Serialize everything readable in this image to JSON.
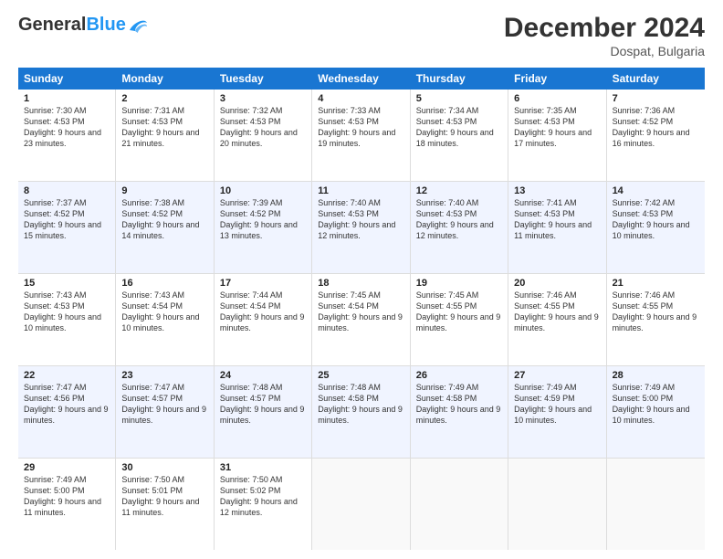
{
  "header": {
    "logo_general": "General",
    "logo_blue": "Blue",
    "month_title": "December 2024",
    "location": "Dospat, Bulgaria"
  },
  "days_of_week": [
    "Sunday",
    "Monday",
    "Tuesday",
    "Wednesday",
    "Thursday",
    "Friday",
    "Saturday"
  ],
  "weeks": [
    [
      {
        "day": "1",
        "sunrise": "7:30 AM",
        "sunset": "4:53 PM",
        "daylight": "9 hours and 23 minutes."
      },
      {
        "day": "2",
        "sunrise": "7:31 AM",
        "sunset": "4:53 PM",
        "daylight": "9 hours and 21 minutes."
      },
      {
        "day": "3",
        "sunrise": "7:32 AM",
        "sunset": "4:53 PM",
        "daylight": "9 hours and 20 minutes."
      },
      {
        "day": "4",
        "sunrise": "7:33 AM",
        "sunset": "4:53 PM",
        "daylight": "9 hours and 19 minutes."
      },
      {
        "day": "5",
        "sunrise": "7:34 AM",
        "sunset": "4:53 PM",
        "daylight": "9 hours and 18 minutes."
      },
      {
        "day": "6",
        "sunrise": "7:35 AM",
        "sunset": "4:53 PM",
        "daylight": "9 hours and 17 minutes."
      },
      {
        "day": "7",
        "sunrise": "7:36 AM",
        "sunset": "4:52 PM",
        "daylight": "9 hours and 16 minutes."
      }
    ],
    [
      {
        "day": "8",
        "sunrise": "7:37 AM",
        "sunset": "4:52 PM",
        "daylight": "9 hours and 15 minutes."
      },
      {
        "day": "9",
        "sunrise": "7:38 AM",
        "sunset": "4:52 PM",
        "daylight": "9 hours and 14 minutes."
      },
      {
        "day": "10",
        "sunrise": "7:39 AM",
        "sunset": "4:52 PM",
        "daylight": "9 hours and 13 minutes."
      },
      {
        "day": "11",
        "sunrise": "7:40 AM",
        "sunset": "4:53 PM",
        "daylight": "9 hours and 12 minutes."
      },
      {
        "day": "12",
        "sunrise": "7:40 AM",
        "sunset": "4:53 PM",
        "daylight": "9 hours and 12 minutes."
      },
      {
        "day": "13",
        "sunrise": "7:41 AM",
        "sunset": "4:53 PM",
        "daylight": "9 hours and 11 minutes."
      },
      {
        "day": "14",
        "sunrise": "7:42 AM",
        "sunset": "4:53 PM",
        "daylight": "9 hours and 10 minutes."
      }
    ],
    [
      {
        "day": "15",
        "sunrise": "7:43 AM",
        "sunset": "4:53 PM",
        "daylight": "9 hours and 10 minutes."
      },
      {
        "day": "16",
        "sunrise": "7:43 AM",
        "sunset": "4:54 PM",
        "daylight": "9 hours and 10 minutes."
      },
      {
        "day": "17",
        "sunrise": "7:44 AM",
        "sunset": "4:54 PM",
        "daylight": "9 hours and 9 minutes."
      },
      {
        "day": "18",
        "sunrise": "7:45 AM",
        "sunset": "4:54 PM",
        "daylight": "9 hours and 9 minutes."
      },
      {
        "day": "19",
        "sunrise": "7:45 AM",
        "sunset": "4:55 PM",
        "daylight": "9 hours and 9 minutes."
      },
      {
        "day": "20",
        "sunrise": "7:46 AM",
        "sunset": "4:55 PM",
        "daylight": "9 hours and 9 minutes."
      },
      {
        "day": "21",
        "sunrise": "7:46 AM",
        "sunset": "4:55 PM",
        "daylight": "9 hours and 9 minutes."
      }
    ],
    [
      {
        "day": "22",
        "sunrise": "7:47 AM",
        "sunset": "4:56 PM",
        "daylight": "9 hours and 9 minutes."
      },
      {
        "day": "23",
        "sunrise": "7:47 AM",
        "sunset": "4:57 PM",
        "daylight": "9 hours and 9 minutes."
      },
      {
        "day": "24",
        "sunrise": "7:48 AM",
        "sunset": "4:57 PM",
        "daylight": "9 hours and 9 minutes."
      },
      {
        "day": "25",
        "sunrise": "7:48 AM",
        "sunset": "4:58 PM",
        "daylight": "9 hours and 9 minutes."
      },
      {
        "day": "26",
        "sunrise": "7:49 AM",
        "sunset": "4:58 PM",
        "daylight": "9 hours and 9 minutes."
      },
      {
        "day": "27",
        "sunrise": "7:49 AM",
        "sunset": "4:59 PM",
        "daylight": "9 hours and 10 minutes."
      },
      {
        "day": "28",
        "sunrise": "7:49 AM",
        "sunset": "5:00 PM",
        "daylight": "9 hours and 10 minutes."
      }
    ],
    [
      {
        "day": "29",
        "sunrise": "7:49 AM",
        "sunset": "5:00 PM",
        "daylight": "9 hours and 11 minutes."
      },
      {
        "day": "30",
        "sunrise": "7:50 AM",
        "sunset": "5:01 PM",
        "daylight": "9 hours and 11 minutes."
      },
      {
        "day": "31",
        "sunrise": "7:50 AM",
        "sunset": "5:02 PM",
        "daylight": "9 hours and 12 minutes."
      },
      null,
      null,
      null,
      null
    ]
  ],
  "labels": {
    "sunrise": "Sunrise:",
    "sunset": "Sunset:",
    "daylight": "Daylight:"
  }
}
